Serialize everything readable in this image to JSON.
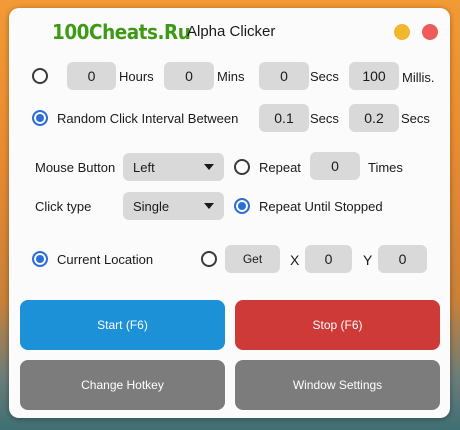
{
  "window": {
    "logo_text": "100Cheats.Ru",
    "title": "Alpha Clicker"
  },
  "interval": {
    "hours_value": "0",
    "hours_label": "Hours",
    "mins_value": "0",
    "mins_label": "Mins",
    "secs_value": "0",
    "secs_label": "Secs",
    "millis_value": "100",
    "millis_label": "Millis.",
    "fixed_selected": false
  },
  "random_interval": {
    "label": "Random Click Interval Between",
    "selected": true,
    "min_value": "0.1",
    "min_label": "Secs",
    "max_value": "0.2",
    "max_label": "Secs"
  },
  "mouse": {
    "button_label": "Mouse Button",
    "button_value": "Left",
    "click_type_label": "Click type",
    "click_type_value": "Single"
  },
  "repeat": {
    "label": "Repeat",
    "selected": false,
    "times_value": "0",
    "times_label": "Times",
    "until_stopped_label": "Repeat Until Stopped",
    "until_stopped_selected": true
  },
  "location": {
    "current_label": "Current Location",
    "current_selected": true,
    "custom_selected": false,
    "get_label": "Get",
    "x_label": "X",
    "x_value": "0",
    "y_label": "Y",
    "y_value": "0"
  },
  "actions": {
    "start_label": "Start (F6)",
    "stop_label": "Stop (F6)",
    "hotkey_label": "Change Hotkey",
    "settings_label": "Window Settings"
  },
  "colors": {
    "start": "#1d91d8",
    "stop": "#cd3a37",
    "secondary": "#7c7c7c",
    "logo": "#3e9a14",
    "radio_selected": "#2b6fd6"
  }
}
